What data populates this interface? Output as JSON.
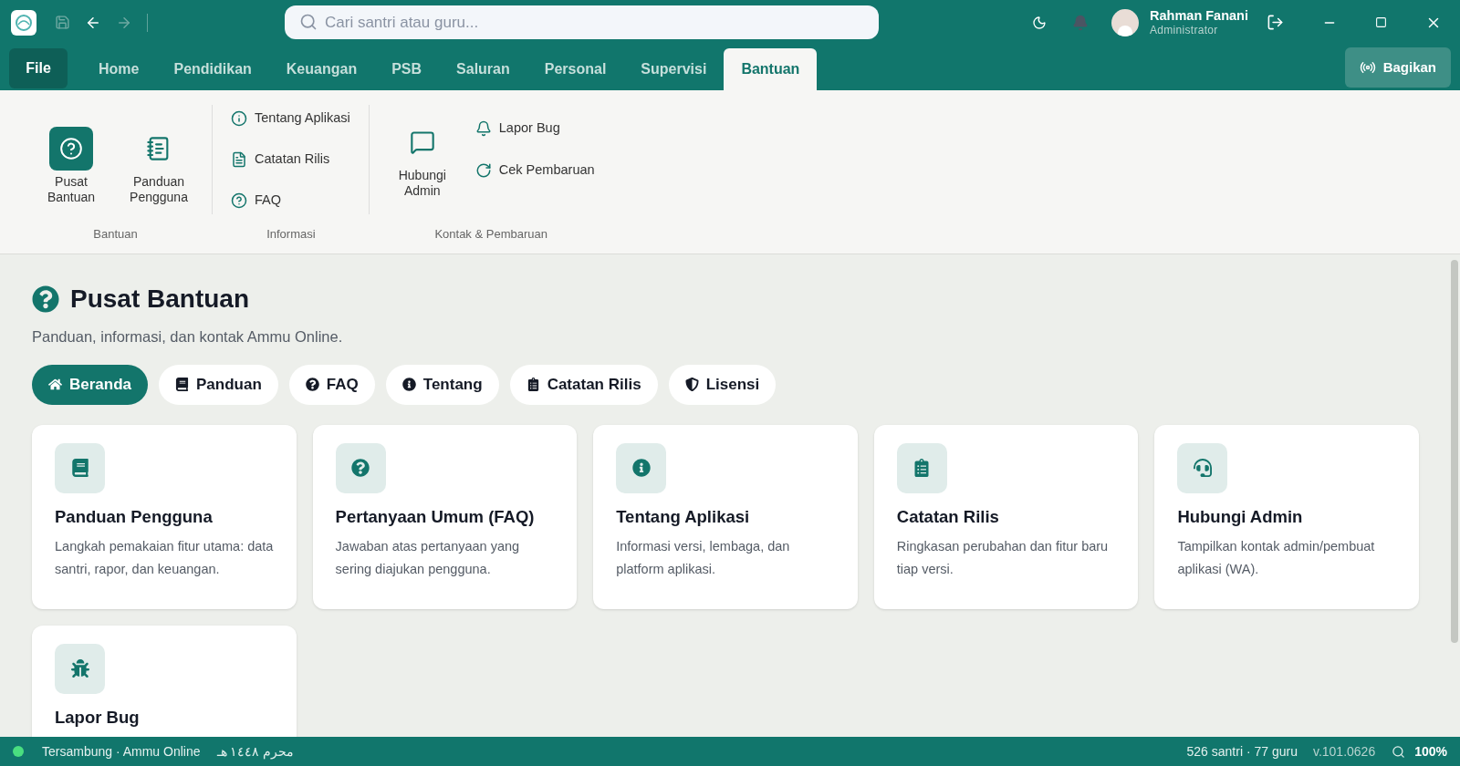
{
  "titlebar": {
    "search": {
      "placeholder": "Cari santri atau guru..."
    },
    "user": {
      "name": "Rahman Fanani",
      "role": "Administrator"
    }
  },
  "menu": {
    "file": "File",
    "tabs": [
      {
        "label": "Home",
        "selected": false
      },
      {
        "label": "Pendidikan",
        "selected": false
      },
      {
        "label": "Keuangan",
        "selected": false
      },
      {
        "label": "PSB",
        "selected": false
      },
      {
        "label": "Saluran",
        "selected": false
      },
      {
        "label": "Personal",
        "selected": false
      },
      {
        "label": "Supervisi",
        "selected": false
      },
      {
        "label": "Bantuan",
        "selected": true
      }
    ],
    "share": "Bagikan"
  },
  "ribbon": {
    "groups": [
      {
        "label": "Bantuan",
        "items": [
          {
            "kind": "large",
            "label": "Pusat Bantuan",
            "selected": true
          },
          {
            "kind": "large",
            "label": "Panduan Pengguna",
            "selected": false
          }
        ]
      },
      {
        "label": "Informasi",
        "items": [
          {
            "kind": "small",
            "label": "Tentang Aplikasi",
            "selected": false
          },
          {
            "kind": "small",
            "label": "Catatan Rilis",
            "selected": false
          },
          {
            "kind": "small",
            "label": "FAQ",
            "selected": false
          }
        ]
      },
      {
        "label": "Kontak & Pembaruan",
        "items": [
          {
            "kind": "large",
            "label": "Hubungi Admin",
            "selected": false
          },
          {
            "kind": "small",
            "label": "Lapor Bug",
            "selected": false
          },
          {
            "kind": "small",
            "label": "Cek Pembaruan",
            "selected": false
          }
        ]
      }
    ]
  },
  "page": {
    "title": "Pusat Bantuan",
    "subtitle": "Panduan, informasi, dan kontak Ammu Online.",
    "chips": [
      {
        "label": "Beranda",
        "selected": true
      },
      {
        "label": "Panduan",
        "selected": false
      },
      {
        "label": "FAQ",
        "selected": false
      },
      {
        "label": "Tentang",
        "selected": false
      },
      {
        "label": "Catatan Rilis",
        "selected": false
      },
      {
        "label": "Lisensi",
        "selected": false
      }
    ],
    "cards": [
      {
        "title": "Panduan Pengguna",
        "text": "Langkah pemakaian fitur utama: data santri, rapor, dan keuangan."
      },
      {
        "title": "Pertanyaan Umum (FAQ)",
        "text": "Jawaban atas pertanyaan yang sering diajukan pengguna."
      },
      {
        "title": "Tentang Aplikasi",
        "text": "Informasi versi, lembaga, dan platform aplikasi."
      },
      {
        "title": "Catatan Rilis",
        "text": "Ringkasan perubahan dan fitur baru tiap versi."
      },
      {
        "title": "Hubungi Admin",
        "text": "Tampilkan kontak admin/pembuat aplikasi (WA)."
      },
      {
        "title": "Lapor Bug"
      }
    ]
  },
  "status_bar": {
    "connected": true,
    "connection": "Tersambung · Ammu Online",
    "hijri": "محرم ١٤٤٨ هـ",
    "counts": "526 santri · 77 guru",
    "version": "v.101.0626",
    "zoom": "100%"
  }
}
